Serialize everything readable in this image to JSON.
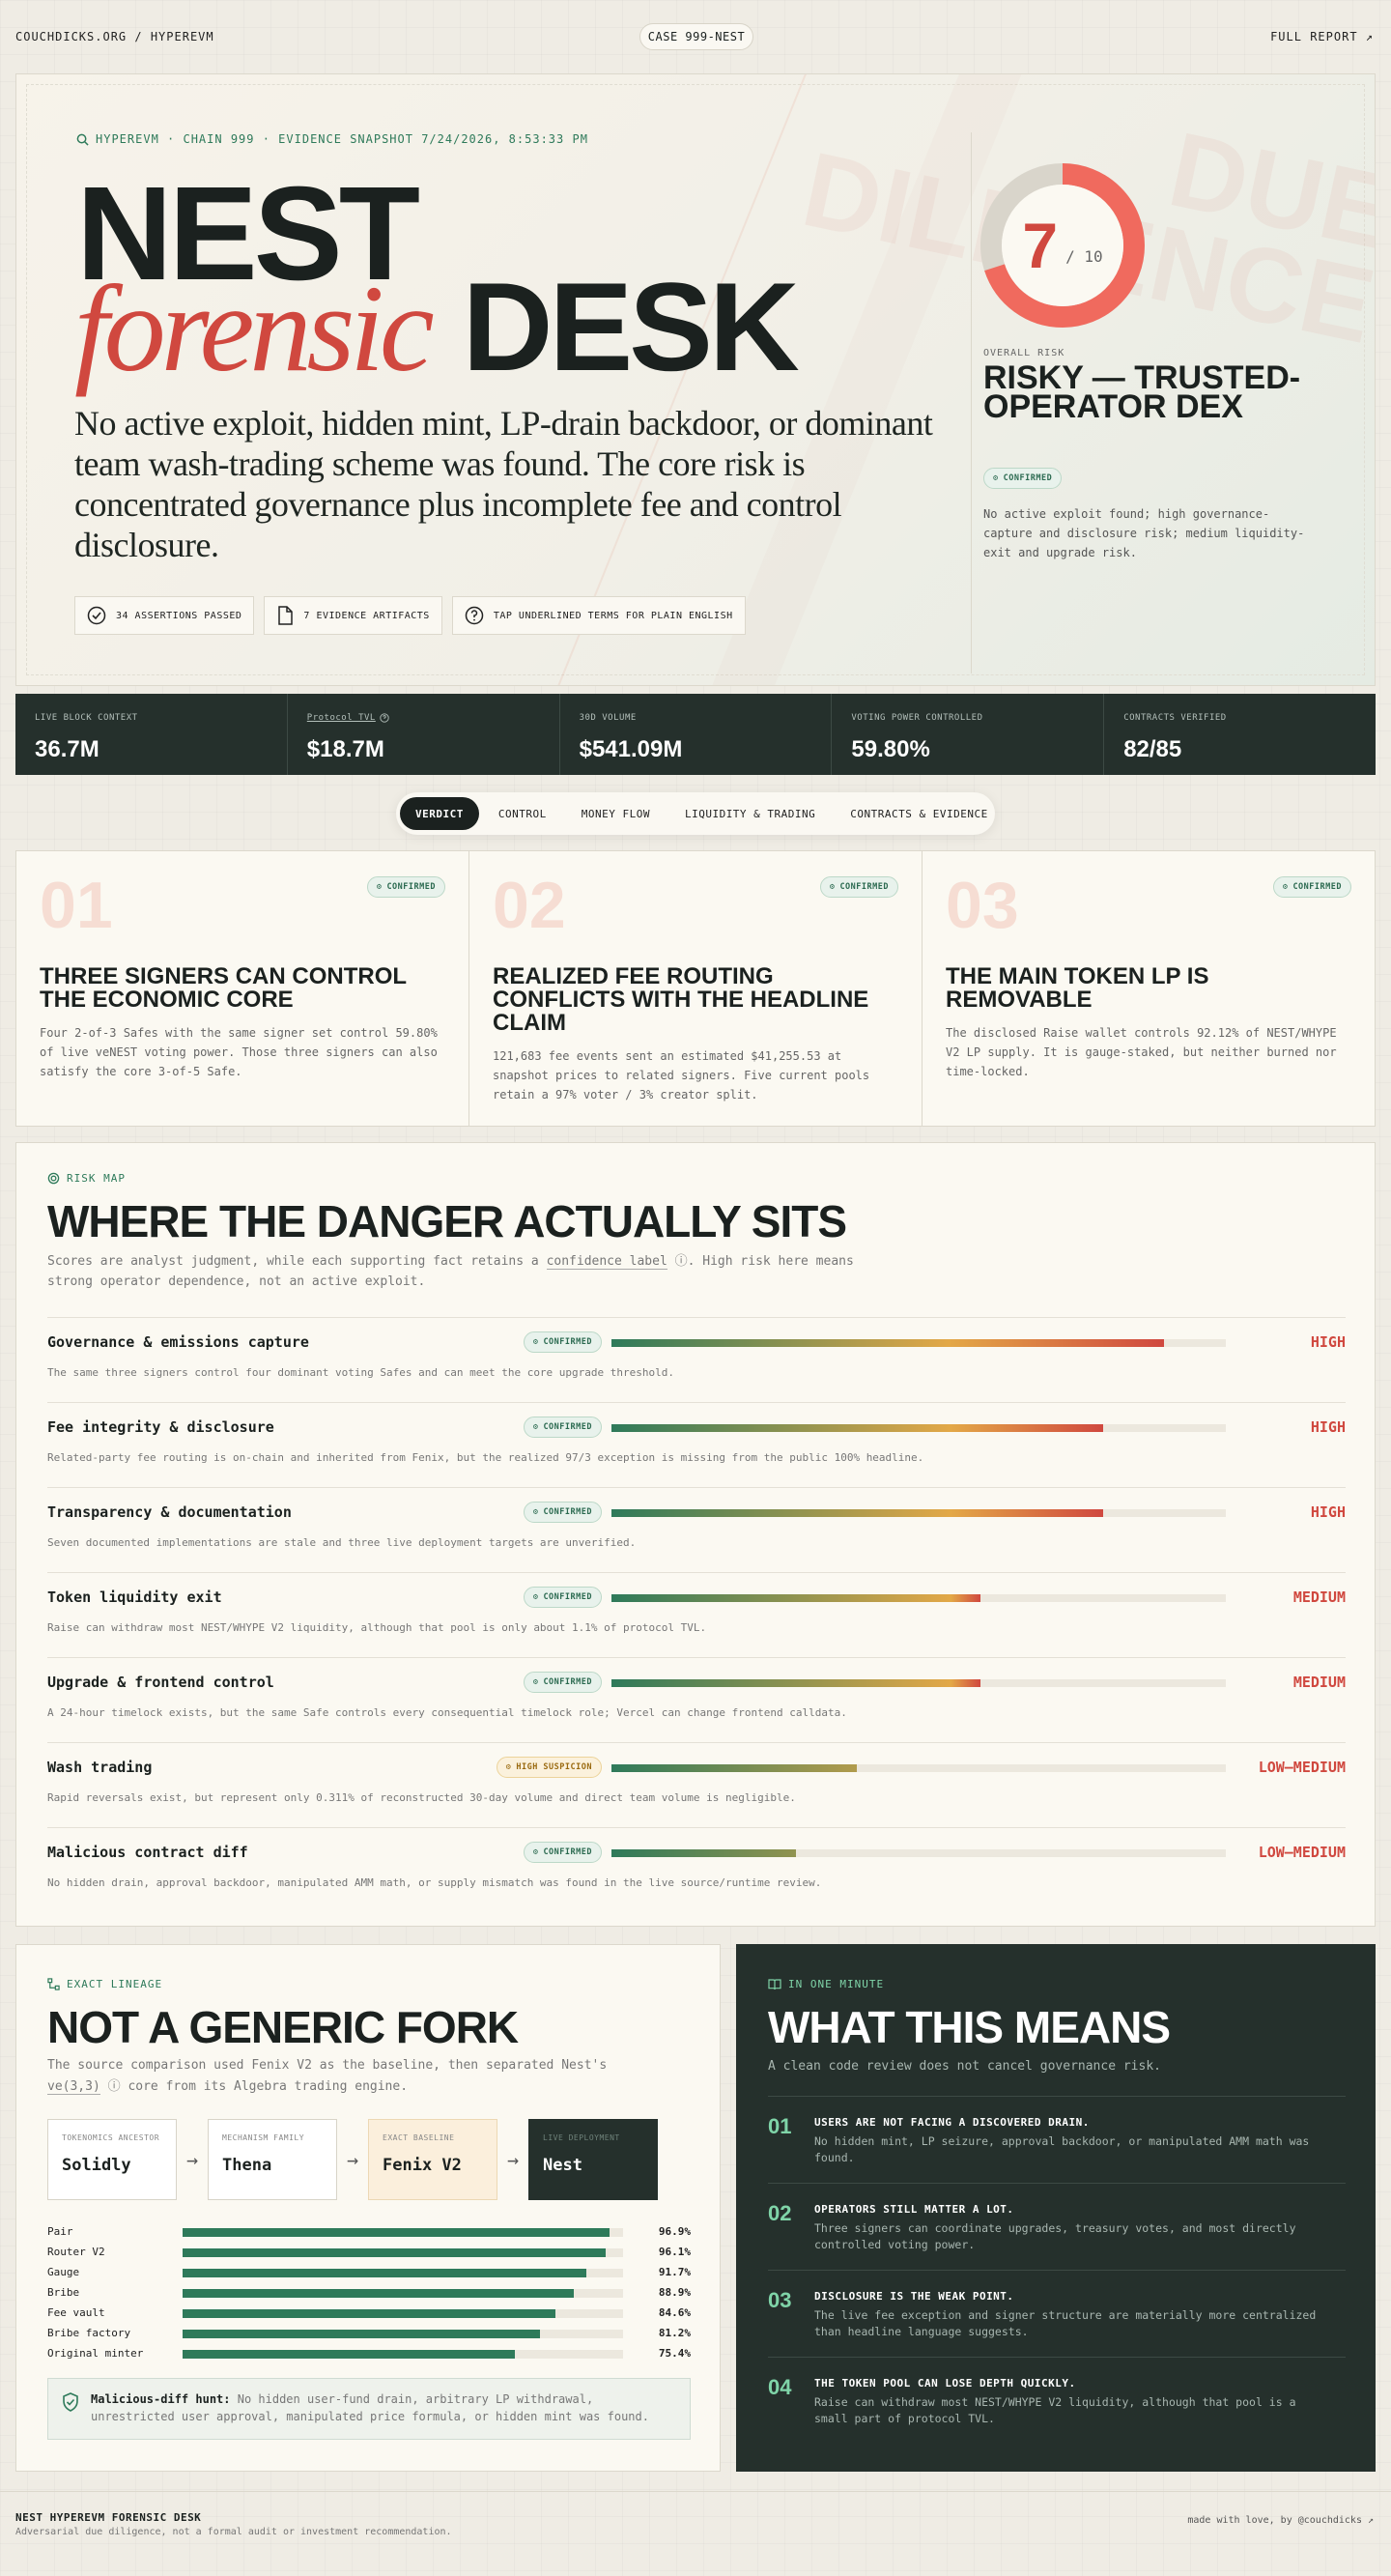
{
  "topbar": {
    "crumb": "COUCHDICKS.ORG / HYPEREVM",
    "case": "CASE 999-NEST",
    "report": "FULL REPORT ↗"
  },
  "hero": {
    "kicker": "HYPEREVM · CHAIN 999 · EVIDENCE SNAPSHOT 7/24/2026, 8:53:33 PM",
    "title_1": "NEST",
    "title_script": "forensic",
    "title_2": "DESK",
    "lede": "No active exploit, hidden mint, LP-drain backdoor, or dominant team wash-trading scheme was found. The core risk is concentrated governance plus incomplete fee and control disclosure.",
    "watermark_1": "DUE",
    "watermark_2": "DILIGENCE",
    "chips": [
      {
        "label": "34 ASSERTIONS PASSED",
        "icon": "check-circle-icon"
      },
      {
        "label": "7 EVIDENCE ARTIFACTS",
        "icon": "document-icon"
      },
      {
        "label": "TAP UNDERLINED TERMS FOR PLAIN ENGLISH",
        "icon": "question-icon"
      }
    ]
  },
  "score": {
    "value": 7,
    "value_text": "7",
    "max_text": "/ 10",
    "fraction": 0.7,
    "label": "OVERALL RISK",
    "title": "RISKY — TRUSTED-OPERATOR DEX",
    "badge": "CONFIRMED",
    "note": "No active exploit found; high governance-capture and disclosure risk; medium liquidity-exit and upgrade risk."
  },
  "stats": [
    {
      "label": "LIVE BLOCK CONTEXT",
      "value": "36.7M"
    },
    {
      "label": "Protocol TVL",
      "value": "$18.7M",
      "underline": true
    },
    {
      "label": "30D VOLUME",
      "value": "$541.09M"
    },
    {
      "label": "VOTING POWER CONTROLLED",
      "value": "59.80%"
    },
    {
      "label": "CONTRACTS VERIFIED",
      "value": "82/85"
    }
  ],
  "tabs": [
    "VERDICT",
    "CONTROL",
    "MONEY FLOW",
    "LIQUIDITY & TRADING",
    "CONTRACTS & EVIDENCE"
  ],
  "findings": [
    {
      "num": "01",
      "badge": "CONFIRMED",
      "title": "THREE SIGNERS CAN CONTROL THE ECONOMIC CORE",
      "desc": "Four 2-of-3 Safes with the same signer set control 59.80% of live veNEST voting power. Those three signers can also satisfy the core 3-of-5 Safe."
    },
    {
      "num": "02",
      "badge": "CONFIRMED",
      "title": "REALIZED FEE ROUTING CONFLICTS WITH THE HEADLINE CLAIM",
      "desc": "121,683 fee events sent an estimated $41,255.53 at snapshot prices to related signers. Five current pools retain a 97% voter / 3% creator split."
    },
    {
      "num": "03",
      "badge": "CONFIRMED",
      "title": "THE MAIN TOKEN LP IS REMOVABLE",
      "desc": "The disclosed Raise wallet controls 92.12% of NEST/WHYPE V2 LP supply. It is gauge-staked, but neither burned nor time-locked."
    }
  ],
  "riskmap": {
    "kicker": "RISK MAP",
    "title": "WHERE THE DANGER ACTUALLY SITS",
    "sub_a": "Scores are analyst judgment, while each supporting fact retains a ",
    "sub_term": "confidence label",
    "sub_b": ". High risk here means strong operator dependence, not an active exploit.",
    "rows": [
      {
        "name": "Governance & emissions capture",
        "badge": "CONFIRMED",
        "level": "HIGH",
        "score": 0.9,
        "desc": "The same three signers control four dominant voting Safes and can meet the core upgrade threshold."
      },
      {
        "name": "Fee integrity & disclosure",
        "badge": "CONFIRMED",
        "level": "HIGH",
        "score": 0.8,
        "desc": "Related-party fee routing is on-chain and inherited from Fenix, but the realized 97/3 exception is missing from the public 100% headline."
      },
      {
        "name": "Transparency & documentation",
        "badge": "CONFIRMED",
        "level": "HIGH",
        "score": 0.8,
        "desc": "Seven documented implementations are stale and three live deployment targets are unverified."
      },
      {
        "name": "Token liquidity exit",
        "badge": "CONFIRMED",
        "level": "MEDIUM",
        "score": 0.6,
        "desc": "Raise can withdraw most NEST/WHYPE V2 liquidity, although that pool is only about 1.1% of protocol TVL."
      },
      {
        "name": "Upgrade & frontend control",
        "badge": "CONFIRMED",
        "level": "MEDIUM",
        "score": 0.6,
        "desc": "A 24-hour timelock exists, but the same Safe controls every consequential timelock role; Vercel can change frontend calldata."
      },
      {
        "name": "Wash trading",
        "badge": "HIGH SUSPICION",
        "level": "LOW–MEDIUM",
        "score": 0.4,
        "desc": "Rapid reversals exist, but represent only 0.311% of reconstructed 30-day volume and direct team volume is negligible.",
        "warn": true
      },
      {
        "name": "Malicious contract diff",
        "badge": "CONFIRMED",
        "level": "LOW–MEDIUM",
        "score": 0.3,
        "desc": "No hidden drain, approval backdoor, manipulated AMM math, or supply mismatch was found in the live source/runtime review."
      }
    ]
  },
  "lineage": {
    "kicker": "EXACT LINEAGE",
    "title": "NOT A GENERIC FORK",
    "sub_a": "The source comparison used Fenix V2 as the baseline, then separated Nest's ",
    "sub_term": "ve(3,3)",
    "sub_b": " core from its Algebra trading engine.",
    "chain": [
      {
        "k": "TOKENOMICS ANCESTOR",
        "v": "Solidly"
      },
      {
        "k": "MECHANISM FAMILY",
        "v": "Thena"
      },
      {
        "k": "EXACT BASELINE",
        "v": "Fenix V2"
      },
      {
        "k": "LIVE DEPLOYMENT",
        "v": "Nest"
      }
    ],
    "bars": [
      {
        "label": "Pair",
        "pct": 96.9,
        "text": "96.9%"
      },
      {
        "label": "Router V2",
        "pct": 96.1,
        "text": "96.1%"
      },
      {
        "label": "Gauge",
        "pct": 91.7,
        "text": "91.7%"
      },
      {
        "label": "Bribe",
        "pct": 88.9,
        "text": "88.9%"
      },
      {
        "label": "Fee vault",
        "pct": 84.6,
        "text": "84.6%"
      },
      {
        "label": "Bribe factory",
        "pct": 81.2,
        "text": "81.2%"
      },
      {
        "label": "Original minter",
        "pct": 75.4,
        "text": "75.4%"
      }
    ],
    "hunt_title": "Malicious-diff hunt:",
    "hunt_text": " No hidden user-fund drain, arbitrary LP withdrawal, unrestricted user approval, manipulated price formula, or hidden mint was found."
  },
  "means": {
    "kicker": "IN ONE MINUTE",
    "title": "WHAT THIS MEANS",
    "sub": "A clean code review does not cancel governance risk.",
    "items": [
      {
        "n": "01",
        "h": "USERS ARE NOT FACING A DISCOVERED DRAIN.",
        "d": "No hidden mint, LP seizure, approval backdoor, or manipulated AMM math was found."
      },
      {
        "n": "02",
        "h": "OPERATORS STILL MATTER A LOT.",
        "d": "Three signers can coordinate upgrades, treasury votes, and most directly controlled voting power."
      },
      {
        "n": "03",
        "h": "DISCLOSURE IS THE WEAK POINT.",
        "d": "The live fee exception and signer structure are materially more centralized than headline language suggests."
      },
      {
        "n": "04",
        "h": "THE TOKEN POOL CAN LOSE DEPTH QUICKLY.",
        "d": "Raise can withdraw most NEST/WHYPE V2 liquidity, although that pool is a small part of protocol TVL."
      }
    ]
  },
  "footer": {
    "title": "NEST HYPEREVM FORENSIC DESK",
    "disclaimer": "Adversarial due diligence, not a formal audit or investment recommendation.",
    "credit": "made with love, by @couchdicks ↗"
  }
}
